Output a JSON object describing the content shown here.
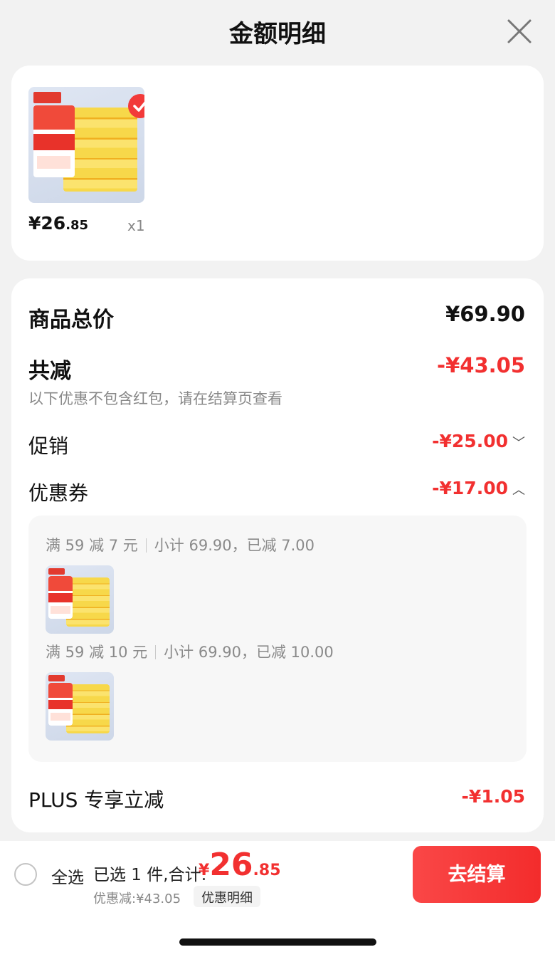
{
  "header": {
    "title": "金额明细",
    "close_icon": "close-icon"
  },
  "product": {
    "price_int": "¥26",
    "price_dec": ".85",
    "quantity": "x1",
    "selected": true
  },
  "summary": {
    "total_label": "商品总价",
    "total_value": "¥69.90",
    "reduce_label": "共减",
    "reduce_value": "-¥43.05",
    "note": "以下优惠不包含红包，请在结算页查看",
    "promo_label": "促销",
    "promo_value": "-¥25.00",
    "coupon_label": "优惠券",
    "coupon_value": "-¥17.00",
    "plus_label": "PLUS 专享立减",
    "plus_value": "-¥1.05"
  },
  "coupons": [
    {
      "rule": "满 59 减 7 元",
      "detail": "小计 69.90，已减 7.00"
    },
    {
      "rule": "满 59 减 10 元",
      "detail": "小计 69.90，已减 10.00"
    }
  ],
  "bottom": {
    "select_all": "全选",
    "selected_text": "已选 1 件,合计:",
    "total_yen": "¥",
    "total_int": "26",
    "total_dec": ".85",
    "discount_text": "优惠减:¥43.05",
    "detail_button": "优惠明细",
    "checkout_button": "去结算"
  },
  "colors": {
    "accent_red": "#f23030",
    "checkout_gradient_start": "#fa4747",
    "checkout_gradient_end": "#f32c2c"
  }
}
